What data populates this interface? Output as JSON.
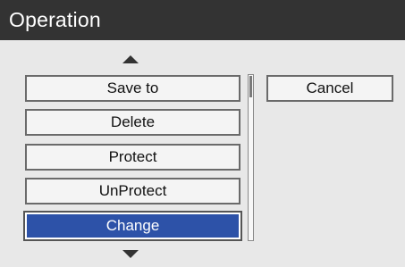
{
  "dialog": {
    "title": "Operation"
  },
  "menu": {
    "items": [
      {
        "label": "Save to"
      },
      {
        "label": "Delete"
      },
      {
        "label": "Protect"
      },
      {
        "label": "UnProtect"
      },
      {
        "label": "Change"
      }
    ],
    "selected_label": "Change",
    "selected_color": "#2d52a8"
  },
  "actions": {
    "cancel_label": "Cancel"
  },
  "icons": {
    "scroll_up": "triangle-up-icon",
    "scroll_down": "triangle-down-icon"
  }
}
